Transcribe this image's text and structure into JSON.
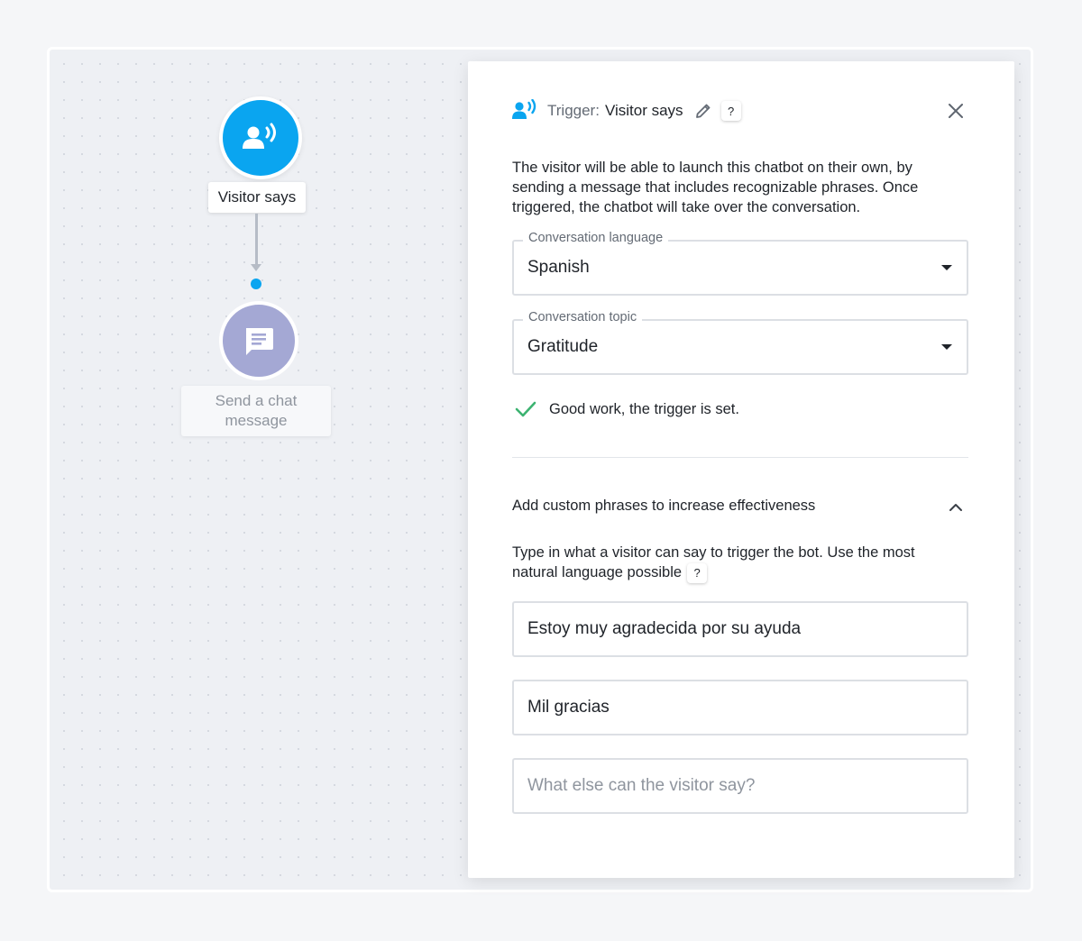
{
  "canvas": {
    "trigger_node": {
      "label": "Visitor says",
      "icon": "speaking-person-icon",
      "color": "#0aa5f0"
    },
    "action_node": {
      "label": "Send a chat message",
      "icon": "chat-message-icon",
      "color": "#a4a8d4"
    },
    "connector_dot_color": "#0aa5f0"
  },
  "panel": {
    "header": {
      "prefix": "Trigger:",
      "name": "Visitor says",
      "help": "?",
      "icons": [
        "speaking-person-icon",
        "pencil-icon",
        "close-icon"
      ]
    },
    "description": "The visitor will be able to launch this chatbot on their own, by sending a message that includes recognizable phrases. Once triggered, the chatbot will take over the conversation.",
    "language_field": {
      "label": "Conversation language",
      "value": "Spanish"
    },
    "topic_field": {
      "label": "Conversation topic",
      "value": "Gratitude"
    },
    "status": {
      "text": "Good work, the trigger is set.",
      "icon": "checkmark-icon",
      "color": "#3cb371"
    },
    "custom_phrases": {
      "title": "Add custom phrases to increase effectiveness",
      "expanded": true,
      "instructions": "Type in what a visitor can say to trigger the bot. Use the most natural language possible",
      "help": "?",
      "phrases": [
        "Estoy muy agradecida por su ayuda",
        "Mil gracias"
      ],
      "new_phrase_placeholder": "What else can the visitor say?"
    }
  }
}
